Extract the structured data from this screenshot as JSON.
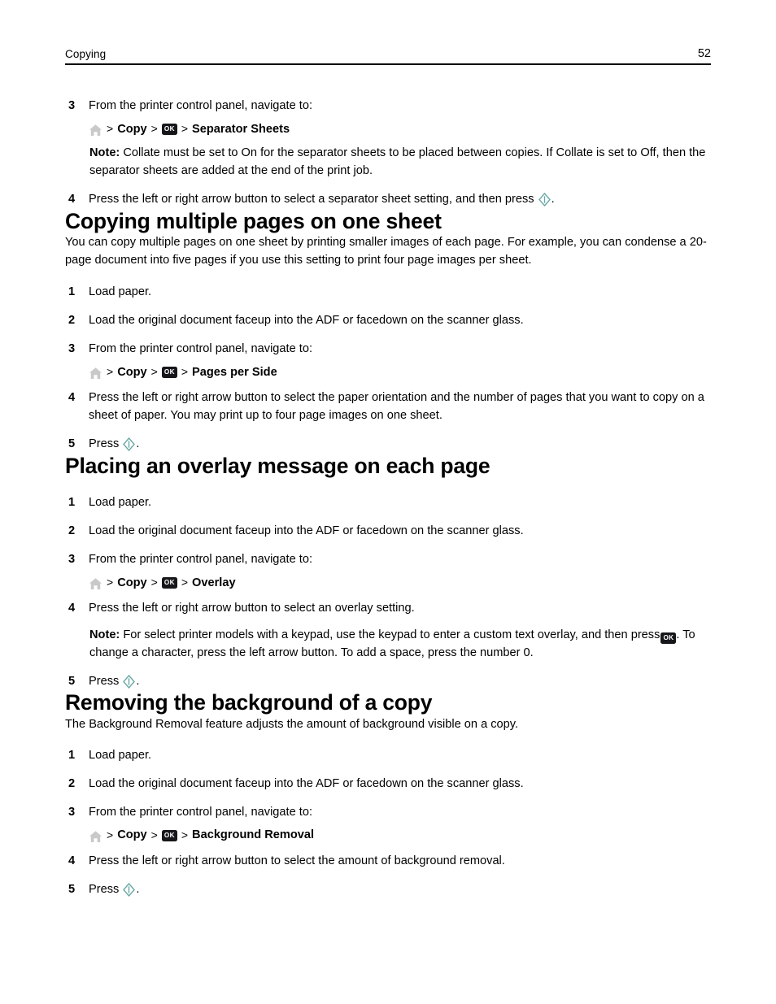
{
  "header": {
    "title": "Copying",
    "page_number": "52"
  },
  "icons": {
    "home": "home-icon",
    "ok": "OK",
    "start": "start-icon",
    "separator": ">"
  },
  "colors": {
    "home_icon": "#c9c9c9",
    "ok_button_bg": "#17161a",
    "ok_button_text": "#ffffff",
    "start_icon": "#6aa9a5",
    "text": "#000000",
    "rule": "#000000"
  },
  "top_steps": [
    {
      "num": "3",
      "text": "From the printer control panel, navigate to:",
      "nav_path": [
        "Copy",
        "Separator Sheets"
      ],
      "note_label": "Note:",
      "note_text": "Collate must be set to On for the separator sheets to be placed between copies. If Collate is set to Off, then the separator sheets are added at the end of the print job."
    },
    {
      "num": "4",
      "text_before": "Press the left or right arrow button to select a separator sheet setting, and then press",
      "text_after": "."
    }
  ],
  "sections": [
    {
      "heading": "Copying multiple pages on one sheet",
      "intro": "You can copy multiple pages on one sheet by printing smaller images of each page. For example, you can condense a 20-page document into five pages if you use this setting to print four page images per sheet.",
      "steps": [
        {
          "num": "1",
          "text": "Load paper."
        },
        {
          "num": "2",
          "text": "Load the original document faceup into the ADF or facedown on the scanner glass."
        },
        {
          "num": "3",
          "text": "From the printer control panel, navigate to:",
          "nav_path": [
            "Copy",
            "Pages per Side"
          ]
        },
        {
          "num": "4",
          "text": "Press the left or right arrow button to select the paper orientation and the number of pages that you want to copy on a sheet of paper. You may print up to four page images on one sheet."
        },
        {
          "num": "5",
          "text_before": "Press",
          "text_after": "."
        }
      ]
    },
    {
      "heading": "Placing an overlay message on each page",
      "intro": "",
      "steps": [
        {
          "num": "1",
          "text": "Load paper."
        },
        {
          "num": "2",
          "text": "Load the original document faceup into the ADF or facedown on the scanner glass."
        },
        {
          "num": "3",
          "text": "From the printer control panel, navigate to:",
          "nav_path": [
            "Copy",
            "Overlay"
          ]
        },
        {
          "num": "4",
          "text": "Press the left or right arrow button to select an overlay setting.",
          "note_label": "Note:",
          "note_text_before": "For select printer models with a keypad, use the keypad to enter a custom text overlay, and then press",
          "note_text_after": ". To change a character, press the left arrow button. To add a space, press the number 0."
        },
        {
          "num": "5",
          "text_before": "Press",
          "text_after": "."
        }
      ]
    },
    {
      "heading": "Removing the background of a copy",
      "intro": "The Background Removal feature adjusts the amount of background visible on a copy.",
      "steps": [
        {
          "num": "1",
          "text": "Load paper."
        },
        {
          "num": "2",
          "text": "Load the original document faceup into the ADF or facedown on the scanner glass."
        },
        {
          "num": "3",
          "text": "From the printer control panel, navigate to:",
          "nav_path": [
            "Copy",
            "Background Removal"
          ]
        },
        {
          "num": "4",
          "text": "Press the left or right arrow button to select the amount of background removal."
        },
        {
          "num": "5",
          "text_before": "Press",
          "text_after": "."
        }
      ]
    }
  ]
}
